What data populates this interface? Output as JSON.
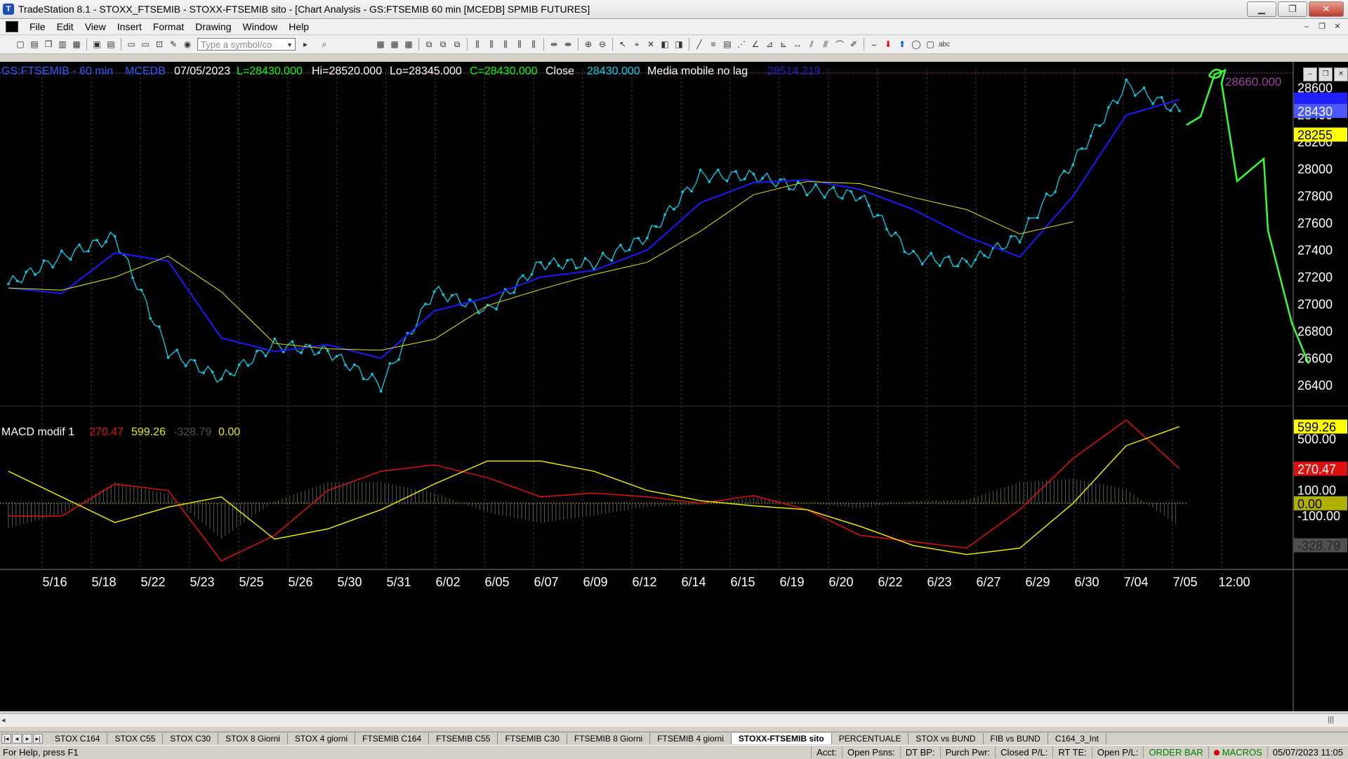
{
  "window": {
    "title": "TradeStation 8.1 - STOXX_FTSEMIB - STOXX-FTSEMIB sito - [Chart Analysis - GS:FTSEMIB  60 min  [MCEDB] SPMIB FUTURES]",
    "app_icon": "T"
  },
  "menu": [
    "File",
    "Edit",
    "View",
    "Insert",
    "Format",
    "Drawing",
    "Window",
    "Help"
  ],
  "toolbar": {
    "symbol_placeholder": "Type a symbol/co"
  },
  "chart": {
    "header": {
      "symbol": "GS:FTSEMIB - 60 min",
      "feed": "MCEDB",
      "date": "07/05/2023",
      "last": "L=28430.000",
      "high": "Hi=28520.000",
      "low": "Lo=28345.000",
      "close": "C=28430.000",
      "close_label": "Close",
      "close_value": "28430.000",
      "indicator_name": "Media mobile no lag",
      "indicator_value": "28514.219",
      "top_level_label": "28660.000"
    },
    "price_axis": {
      "ticks": [
        "28600",
        "28400",
        "28200",
        "28000",
        "27800",
        "27600",
        "27400",
        "27200",
        "27000",
        "26800",
        "26600",
        "26400"
      ],
      "tags": {
        "blue": "28514",
        "last": "28430",
        "yellow": "28255"
      }
    },
    "macd": {
      "name": "MACD modif 1",
      "v1": "270.47",
      "v2": "599.26",
      "v3": "-328.79",
      "v4": "0.00",
      "axis_ticks": [
        "500.00",
        "100.00",
        "-100.00"
      ],
      "tags": {
        "yellow": "599.26",
        "red": "270.47",
        "zero": "0.00",
        "hist": "-328.79"
      }
    },
    "date_axis": [
      "5/16",
      "5/18",
      "5/22",
      "5/23",
      "5/25",
      "5/26",
      "5/30",
      "5/31",
      "6/02",
      "6/05",
      "6/07",
      "6/09",
      "6/12",
      "6/14",
      "6/15",
      "6/19",
      "6/20",
      "6/22",
      "6/23",
      "6/27",
      "6/29",
      "6/30",
      "7/04",
      "7/05",
      "12:00"
    ],
    "colors": {
      "price": "#00d0e8",
      "ma_blue": "#1a1aff",
      "ma_yellow": "#e6e600",
      "macd_red": "#e01010",
      "signal_yellow": "#e6e600",
      "drawing_green": "#33ff33",
      "histogram": "#606060"
    }
  },
  "chart_data": {
    "type": "line",
    "title": "GS:FTSEMIB - 60 min",
    "x": [
      "5/16",
      "5/18",
      "5/22",
      "5/23",
      "5/25",
      "5/26",
      "5/30",
      "5/31",
      "6/02",
      "6/05",
      "6/07",
      "6/09",
      "6/12",
      "6/14",
      "6/15",
      "6/19",
      "6/20",
      "6/22",
      "6/23",
      "6/27",
      "6/29",
      "6/30",
      "7/04"
    ],
    "series": [
      {
        "name": "Close",
        "values": [
          27150,
          27350,
          27500,
          26650,
          26450,
          26700,
          26650,
          26400,
          27100,
          26950,
          27300,
          27300,
          27500,
          27950,
          27950,
          27850,
          27800,
          27350,
          27300,
          27500,
          28050,
          28620,
          28430
        ]
      },
      {
        "name": "Media mobile no lag",
        "values": [
          27120,
          27080,
          27380,
          27320,
          26750,
          26650,
          26700,
          26600,
          26950,
          27050,
          27200,
          27250,
          27400,
          27750,
          27900,
          27920,
          27850,
          27700,
          27500,
          27350,
          27800,
          28400,
          28514
        ]
      }
    ],
    "ylim": [
      26300,
      28700
    ],
    "macd": {
      "x": [
        "5/16",
        "5/18",
        "5/22",
        "5/23",
        "5/25",
        "5/26",
        "5/30",
        "5/31",
        "6/02",
        "6/05",
        "6/07",
        "6/09",
        "6/12",
        "6/14",
        "6/15",
        "6/19",
        "6/20",
        "6/22",
        "6/23",
        "6/27",
        "6/29",
        "6/30",
        "7/04"
      ],
      "macd": [
        -100,
        -100,
        150,
        100,
        -450,
        -250,
        100,
        250,
        300,
        200,
        50,
        80,
        50,
        0,
        60,
        -50,
        -250,
        -300,
        -350,
        -50,
        350,
        650,
        270
      ],
      "signal": [
        250,
        50,
        -150,
        -30,
        50,
        -280,
        -200,
        -50,
        150,
        330,
        330,
        250,
        100,
        20,
        -20,
        -50,
        -180,
        -330,
        -400,
        -350,
        0,
        450,
        599
      ],
      "ylim": [
        -500,
        750
      ]
    }
  }
}
